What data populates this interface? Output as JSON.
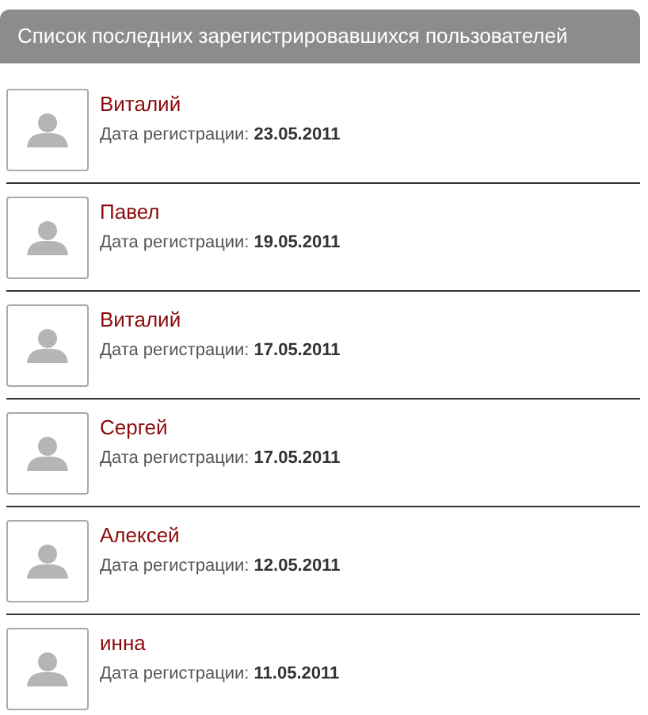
{
  "header": {
    "title": "Список последних зарегистрировавшихся пользователей"
  },
  "users": [
    {
      "name": "Виталий",
      "registered": "Дата регистрации: **23.05.2011**"
    },
    {
      "name": "Павел",
      "registered": "Дата регистрации: **19.05.2011**"
    },
    {
      "name": "Виталий",
      "registered": "Дата регистрации: **17.05.2011**"
    },
    {
      "name": "Сергей",
      "registered": "Дата регистрации: **17.05.2011**"
    },
    {
      "name": "Алексей",
      "registered": "Дата регистрации: **12.05.2011**"
    },
    {
      "name": "инна",
      "registered": "Дата регистрации: **11.05.2011**"
    }
  ]
}
